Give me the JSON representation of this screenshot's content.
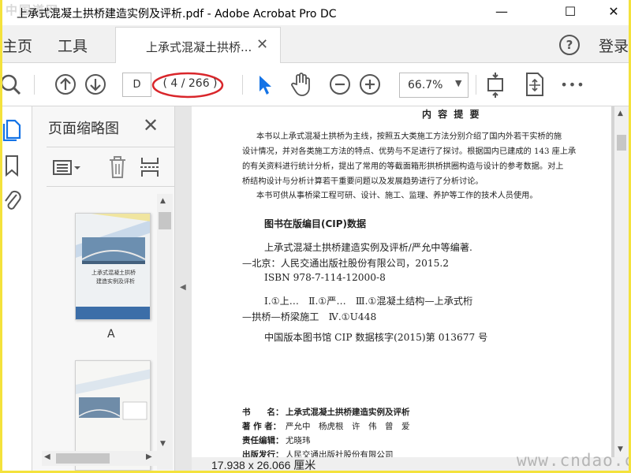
{
  "window": {
    "title": "上承式混凝土拱桥建造实例及评析.pdf - Adobe Acrobat Pro DC",
    "watermark_top": "中国道网",
    "minimize": "—",
    "maximize": "☐",
    "close": "✕"
  },
  "tabs": {
    "home": "主页",
    "tools": "工具",
    "document": "上承式混凝土拱桥...",
    "doc_close": "✕",
    "help": "?",
    "login": "登录"
  },
  "toolbar": {
    "page_input": "D",
    "page_count": "( 4 / 266 )",
    "zoom": "66.7%",
    "more": "•••"
  },
  "pane": {
    "title": "页面缩略图",
    "close": "✕",
    "thumb_label": "A",
    "cover_title_line1": "上承式混凝土拱桥",
    "cover_title_line2": "建造实例及评析"
  },
  "document": {
    "heading": "内 容 提 要",
    "abstract_lines": [
      "本书以上承式混凝土拱桥为主线，按照五大类施工方法分别介绍了国内外若干实桥的施",
      "设计情况，并对各类施工方法的特点、优势与不足进行了探讨。根据国内已建成的 143 座上承",
      "的有关资料进行统计分析，提出了常用的等截面箱形拱桥拱圈构造与设计的参考数据。对上",
      "桥结构设计与分析计算若干重要问题以及发展趋势进行了分析讨论。",
      "本书可供从事桥梁工程可研、设计、施工、监理、养护等工作的技术人员使用。"
    ],
    "cip_heading": "图书在版编目(CIP)数据",
    "cip_lines": [
      "上承式混凝土拱桥建造实例及评析/严允中等编著.",
      "—北京：人民交通出版社股份有限公司，2015.2",
      "ISBN 978-7-114-12000-8",
      "Ⅰ.①上…　Ⅱ.①严…　Ⅲ.①混凝土结构—上承式桁",
      "—拱桥—桥梁施工　Ⅳ.①U448",
      "中国版本图书馆 CIP 数据核字(2015)第 013677 号"
    ],
    "book_name_label": "书　　名：",
    "book_name": "上承式混凝土拱桥建造实例及评析",
    "authors_label": "著 作 者：",
    "authors": "严允中　杨虎根　许　伟　曾　爱",
    "editor_label": "责任编辑：",
    "editor": "尤晓玮",
    "publisher_label": "出版发行：",
    "publisher": "人民交通出版社股份有限公司"
  },
  "status": {
    "page_size": "17.938 x 26.066 厘米",
    "watermark": "www.cndao.com"
  },
  "colors": {
    "accent_blue": "#1473e6",
    "annotation_red": "#d9262b",
    "frame_yellow": "#f4e23c"
  }
}
